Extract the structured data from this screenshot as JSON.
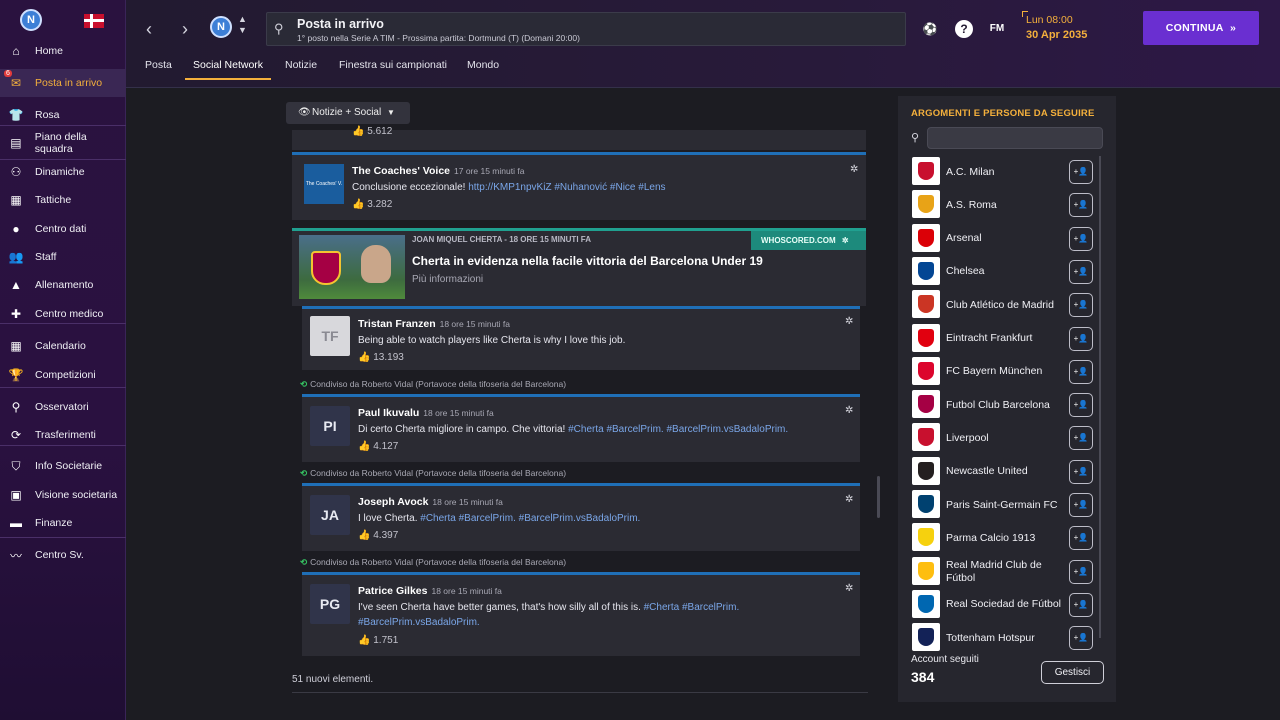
{
  "sidebar": {
    "items": [
      {
        "label": "Home",
        "icon": "home-icon"
      },
      {
        "label": "Posta in arrivo",
        "icon": "inbox-icon",
        "badge": "6"
      },
      {
        "label": "Rosa",
        "icon": "shirt-icon"
      },
      {
        "label": "Piano della squadra",
        "icon": "clipboard-icon"
      },
      {
        "label": "Dinamiche",
        "icon": "dynamics-icon"
      },
      {
        "label": "Tattiche",
        "icon": "tactics-icon"
      },
      {
        "label": "Centro dati",
        "icon": "data-icon"
      },
      {
        "label": "Staff",
        "icon": "staff-icon"
      },
      {
        "label": "Allenamento",
        "icon": "training-icon"
      },
      {
        "label": "Centro medico",
        "icon": "medical-icon"
      },
      {
        "label": "Calendario",
        "icon": "calendar-icon"
      },
      {
        "label": "Competizioni",
        "icon": "trophy-icon"
      },
      {
        "label": "Osservatori",
        "icon": "scout-icon"
      },
      {
        "label": "Trasferimenti",
        "icon": "transfer-icon"
      },
      {
        "label": "Info Societarie",
        "icon": "shield-icon"
      },
      {
        "label": "Visione societaria",
        "icon": "briefcase-icon"
      },
      {
        "label": "Finanze",
        "icon": "money-icon"
      },
      {
        "label": "Centro Sv.",
        "icon": "development-icon"
      }
    ]
  },
  "header": {
    "title": "Posta in arrivo",
    "subtitle": "1° posto nella Serie A TIM - Prossima partita: Dortmund (T) (Domani 20:00)",
    "fm_label": "FM",
    "date_line1": "Lun 08:00",
    "date_line2": "30 Apr 2035",
    "continue_label": "CONTINUA",
    "continue_arrow": "»",
    "team_badge": "N"
  },
  "tabs": [
    "Posta",
    "Social Network",
    "Notizie",
    "Finestra sui campionati",
    "Mondo"
  ],
  "filter_label": "Notizie + Social",
  "feed": {
    "top_likes": "5.612",
    "coaches_voice": {
      "name": "The Coaches' Voice",
      "time": "17 ore 15 minuti fa",
      "text": "Conclusione eccezionale!",
      "link": "http://KMP1npvKiZ #Nuhanović #Nice #Lens",
      "likes": "3.282",
      "logo_text": "The Coaches' V."
    },
    "news": {
      "byline": "JOAN MIQUEL CHERTA  -  18 ORE 15 MINUTI FA",
      "source": "WHOSCORED.COM",
      "headline": "Cherta in evidenza nella facile vittoria del Barcelona Under 19",
      "more": "Più informazioni"
    },
    "posts": [
      {
        "initials": "TF",
        "name": "Tristan Franzen",
        "time": "18 ore 15 minuti fa",
        "text": "Being able to watch players like Cherta is why I love this job.",
        "hashtags": "",
        "hashtags2": "",
        "likes": "13.193"
      },
      {
        "initials": "PI",
        "name": "Paul Ikuvalu",
        "time": "18 ore 15 minuti fa",
        "text": "Di certo Cherta migliore in campo. Che vittoria!",
        "hashtags": "#Cherta #BarcelPrim. #BarcelPrim.vsBadaloPrim.",
        "hashtags2": "",
        "likes": "4.127",
        "shared": "Condiviso da Roberto Vidal (Portavoce della tifoseria del Barcelona)"
      },
      {
        "initials": "JA",
        "name": "Joseph Avock",
        "time": "18 ore 15 minuti fa",
        "text": "I love Cherta.",
        "hashtags": "#Cherta #BarcelPrim. #BarcelPrim.vsBadaloPrim.",
        "hashtags2": "",
        "likes": "4.397",
        "shared": "Condiviso da Roberto Vidal (Portavoce della tifoseria del Barcelona)"
      },
      {
        "initials": "PG",
        "name": "Patrice Gilkes",
        "time": "18 ore 15 minuti fa",
        "text": "I've seen Cherta have better games, that's how silly all of this is.",
        "hashtags": "#Cherta #BarcelPrim.",
        "hashtags2": "#BarcelPrim.vsBadaloPrim.",
        "likes": "1.751",
        "shared": "Condiviso da Roberto Vidal (Portavoce della tifoseria del Barcelona)"
      }
    ],
    "shared_first": "Condiviso da Roberto Vidal (Portavoce della tifoseria del Barcelona)",
    "new_items": "51 nuovi elementi."
  },
  "right_panel": {
    "title": "ARGOMENTI E PERSONE DA SEGUIRE",
    "teams": [
      {
        "name": "A.C. Milan",
        "color": "#c8102e"
      },
      {
        "name": "A.S. Roma",
        "color": "#e8a317"
      },
      {
        "name": "Arsenal",
        "color": "#db0007"
      },
      {
        "name": "Chelsea",
        "color": "#034694"
      },
      {
        "name": "Club Atlético de Madrid",
        "color": "#cb3524"
      },
      {
        "name": "Eintracht Frankfurt",
        "color": "#e1000f"
      },
      {
        "name": "FC Bayern München",
        "color": "#dc052d"
      },
      {
        "name": "Futbol Club Barcelona",
        "color": "#a50044"
      },
      {
        "name": "Liverpool",
        "color": "#c8102e"
      },
      {
        "name": "Newcastle United",
        "color": "#241f20"
      },
      {
        "name": "Paris Saint-Germain FC",
        "color": "#004170"
      },
      {
        "name": "Parma Calcio 1913",
        "color": "#f6d10e"
      },
      {
        "name": "Real Madrid Club de Fútbol",
        "color": "#febe10"
      },
      {
        "name": "Real Sociedad de Fútbol",
        "color": "#0067b1"
      },
      {
        "name": "Tottenham Hotspur",
        "color": "#132257"
      }
    ],
    "accounts_label": "Account seguiti",
    "accounts_count": "384",
    "manage_label": "Gestisci"
  },
  "colors": {
    "accent": "#f4b03c",
    "primary_button": "#6a2fd1",
    "link": "#7aa6e8",
    "news_accent": "#20a090"
  }
}
